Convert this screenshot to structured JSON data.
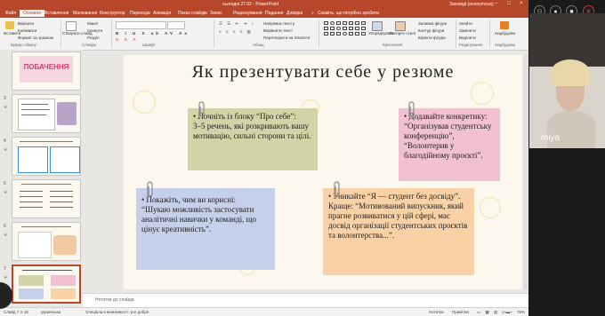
{
  "window": {
    "title": "сьогодні 27.02 - PowerPoint",
    "user": "Заповіді (anonymous)"
  },
  "tabs": [
    "Файл",
    "Основне",
    "Вставлення",
    "Малювання",
    "Конструктор",
    "Переходи",
    "Анімація",
    "Показ слайдів",
    "Запис",
    "Рецензування",
    "Подання",
    "Довідка"
  ],
  "ribbon": {
    "search": "Скажіть, що потрібно зробити",
    "paste": "Вставити",
    "cut": "Вирізати",
    "copy": "Копіювати",
    "format_painter": "Формат за зразком",
    "new_slide": "Створити слайд",
    "layout": "Макет",
    "reset": "Скинути",
    "section": "Розділ",
    "arrange": "Упорядкувати",
    "quick_styles": "Експрес-стилі",
    "shape_fill": "Заливка фігури",
    "shape_outline": "Контур фігури",
    "shape_effects": "Ефекти фігури",
    "find": "Знайти",
    "replace": "Замінити",
    "select": "Виділити",
    "sensitivity": "Надбудови",
    "text_direction": "Напрямок тексту",
    "align_text": "Вирівняти текст",
    "smartart": "Перетворити на SmartArt",
    "groups": [
      "Буфер обміну",
      "Слайди",
      "Шрифт",
      "Абзац",
      "Креслення",
      "Редагування",
      "Надбудови"
    ]
  },
  "thumbnails": [
    {
      "num": "",
      "title": "ПОБАЧЕННЯ"
    },
    {
      "num": "3",
      "title": ""
    },
    {
      "num": "4",
      "title": ""
    },
    {
      "num": "5",
      "title": ""
    },
    {
      "num": "6",
      "title": ""
    },
    {
      "num": "7",
      "title": ""
    }
  ],
  "slide": {
    "title": "Як презентувати себе у резюме",
    "cards": [
      {
        "text": "•  Почніть із блоку “Про себе”:\n3–5 речень, які розкривають вашу мотивацію, сильні сторони та цілі."
      },
      {
        "text": "•  Додавайте конкретику:\n“Організував студентську конференцію”, “Волонтерив у благодійному проєкті”."
      },
      {
        "text": "•  Покажіть, чим ви корисні:\n“Шукаю можливість застосувати аналітичні навички у команді, що цінує креативність”."
      },
      {
        "text": "•  Уникайте “Я — студент без досвіду”.\nКраще: “Мотивований випускник, який прагне розвиватися у цій сфері, має досвід організації студентських проєктів та волонтерства...”."
      }
    ],
    "colors": {
      "card_green": "#d3d3a8",
      "card_pink": "#f2c1d1",
      "card_blue": "#c6d0ea",
      "card_orange": "#f9d1a7"
    }
  },
  "notes": {
    "placeholder": "Нотатки до слайда"
  },
  "status": {
    "slide": "Слайд 7 із 16",
    "language": "українська",
    "accessibility": "Спеціальні можливості: усе добре",
    "notes": "Нотатки",
    "comments": "Примітки",
    "zoom": "75%"
  },
  "video": {
    "name": "miya"
  }
}
